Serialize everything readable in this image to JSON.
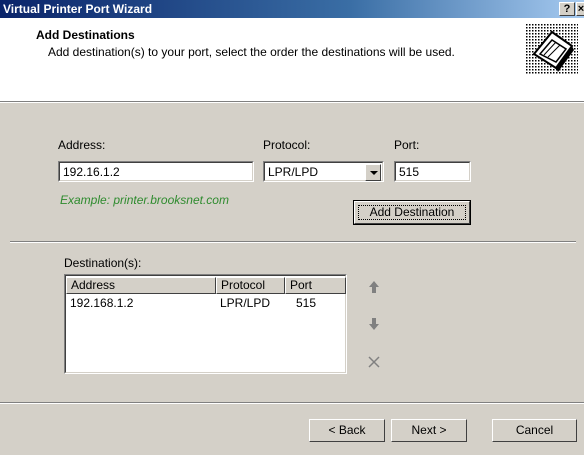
{
  "window": {
    "title": "Virtual Printer Port Wizard",
    "help_glyph": "?",
    "close_glyph": "×"
  },
  "header": {
    "title": "Add Destinations",
    "subtitle": "Add destination(s) to your port, select the order the destinations will be used."
  },
  "form": {
    "address_label": "Address:",
    "address_value": "192.16.1.2",
    "protocol_label": "Protocol:",
    "protocol_value": "LPR/LPD",
    "port_label": "Port:",
    "port_value": "515",
    "example": "Example: printer.brooksnet.com",
    "add_button": "Add Destination"
  },
  "destinations": {
    "label": "Destination(s):",
    "columns": [
      "Address",
      "Protocol",
      "Port"
    ],
    "rows": [
      {
        "address": "192.168.1.2",
        "protocol": "LPR/LPD",
        "port": "515"
      }
    ],
    "move_up_icon": "up-arrow-icon",
    "move_down_icon": "down-arrow-icon",
    "remove_icon": "x-icon"
  },
  "footer": {
    "back": "< Back",
    "next": "Next >",
    "cancel": "Cancel"
  },
  "colors": {
    "titlebar_start": "#0a246a",
    "titlebar_end": "#a6caf0",
    "dialog_face": "#d4d0c8",
    "example_text": "#2e8b2e"
  }
}
